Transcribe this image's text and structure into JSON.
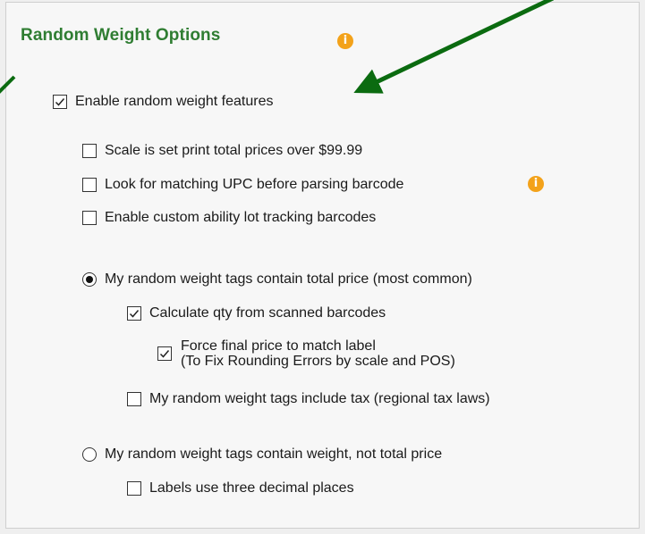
{
  "panel": {
    "title": "Random Weight Options",
    "info_icon_glyph": "i"
  },
  "options": {
    "enable_random_weight": {
      "label": "Enable random weight features",
      "checked": true
    },
    "scale_total_prices": {
      "label": "Scale is set print total prices over $99.99",
      "checked": false
    },
    "matching_upc": {
      "label": "Look for matching UPC before parsing barcode",
      "checked": false
    },
    "custom_lot_tracking": {
      "label": "Enable custom ability lot tracking barcodes",
      "checked": false
    },
    "tags_total_price": {
      "label": "My random weight tags contain total price (most common)",
      "selected": true
    },
    "calc_qty": {
      "label": "Calculate qty from scanned barcodes",
      "checked": true
    },
    "force_final_price": {
      "label_line1": "Force final price to match label",
      "label_line2": "(To Fix Rounding Errors by scale and POS)",
      "checked": true
    },
    "tags_include_tax": {
      "label": "My random weight tags include tax (regional tax laws)",
      "checked": false
    },
    "tags_weight": {
      "label": "My random weight tags contain weight, not total price",
      "selected": false
    },
    "three_decimals": {
      "label": "Labels use three decimal places",
      "checked": false
    }
  },
  "colors": {
    "title_green": "#2f7d32",
    "info_orange": "#f3a21a",
    "arrow_green": "#0b6b10"
  }
}
